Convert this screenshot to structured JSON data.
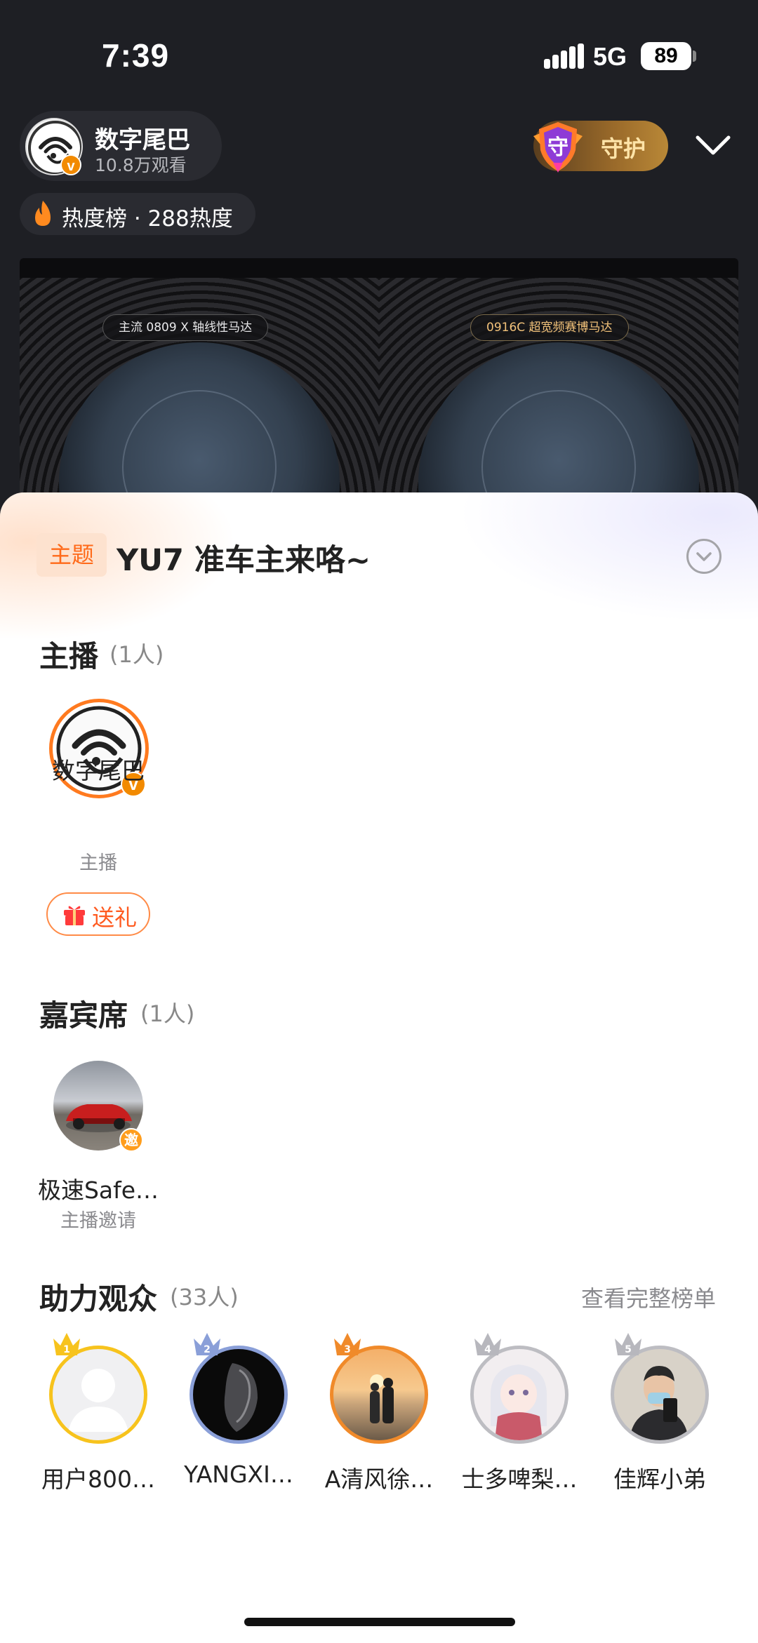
{
  "status_bar": {
    "time": "7:39",
    "network": "5G",
    "battery": "89"
  },
  "stream": {
    "host_name": "数字尾巴",
    "viewers": "10.8万观看",
    "guard_label": "守护",
    "guard_shield_char": "守",
    "verified_badge": "v",
    "hot_label": "热度榜 · 288热度",
    "video_tags": [
      "主流 0809 X 轴线性马达",
      "0916C 超宽频赛博马达"
    ]
  },
  "sheet": {
    "topic_badge": "主题",
    "topic_title": "YU7 准车主来咯~",
    "host_section": {
      "title": "主播",
      "count": "(1人)"
    },
    "host": {
      "name": "数字尾巴",
      "role": "主播",
      "gift_label": "送礼"
    },
    "guest_section": {
      "title": "嘉宾席",
      "count": "(1人)"
    },
    "guest": {
      "name": "极速Safe…",
      "role": "主播邀请",
      "badge": "邀"
    },
    "audience_section": {
      "title": "助力观众",
      "count": "(33人)",
      "view_all": "查看完整榜单"
    },
    "audience": [
      {
        "rank": "1",
        "name": "用户800…"
      },
      {
        "rank": "2",
        "name": "YANGXI…"
      },
      {
        "rank": "3",
        "name": "A清风徐…"
      },
      {
        "rank": "4",
        "name": "士多啤梨…"
      },
      {
        "rank": "5",
        "name": "佳辉小弟"
      }
    ]
  },
  "colors": {
    "accent_orange": "#ff6a1a",
    "rank_gold": "#f7c31d",
    "rank_silver_blue": "#8a9fd8",
    "rank_bronze": "#f08a2a",
    "rank_grey": "#bdbdc2"
  },
  "icons": [
    "signal-icon",
    "battery-icon",
    "verified-icon",
    "guard-shield-icon",
    "chevron-down-icon",
    "flame-icon",
    "gift-icon",
    "crown-icon"
  ]
}
